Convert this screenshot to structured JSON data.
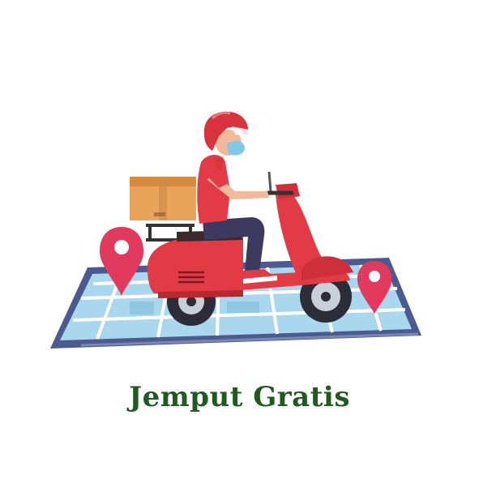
{
  "caption": {
    "text": "Jemput Gratis"
  },
  "illustration": {
    "subject": "delivery-scooter-rider",
    "icons": [
      "delivery-box-icon",
      "location-pin-icon",
      "map-tablet-icon",
      "scooter-icon"
    ]
  },
  "colors": {
    "caption": "#1f5a1e",
    "scooter_red": "#e23b45",
    "helmet_red": "#d8333d",
    "box_orange": "#e9a45a",
    "map_blue": "#9fd0ea",
    "tablet_frame": "#4b5a8f",
    "pin_pink": "#e23a5c",
    "mask_blue": "#7ec9ea"
  }
}
